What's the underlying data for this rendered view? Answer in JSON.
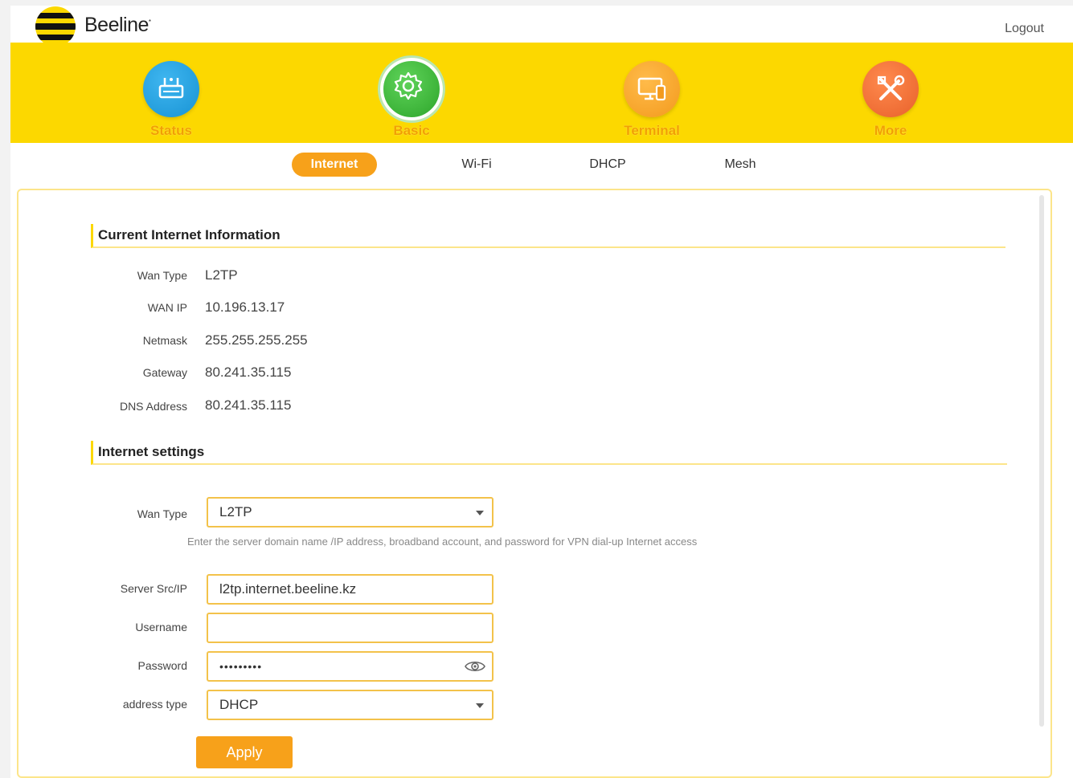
{
  "brand": {
    "name": "Beeline",
    "mark": "*"
  },
  "header": {
    "logout": "Logout"
  },
  "nav": [
    {
      "label": "Status",
      "icon": "router-icon",
      "color": "#1893d4"
    },
    {
      "label": "Basic",
      "icon": "gear-icon",
      "color": "#2da52a",
      "active": true
    },
    {
      "label": "Terminal",
      "icon": "devices-icon",
      "color": "#f39a1d"
    },
    {
      "label": "More",
      "icon": "tools-icon",
      "color": "#e8612a"
    }
  ],
  "tabs": [
    {
      "label": "Internet",
      "active": true
    },
    {
      "label": "Wi-Fi"
    },
    {
      "label": "DHCP"
    },
    {
      "label": "Mesh"
    }
  ],
  "current": {
    "title": "Current Internet Information",
    "rows": [
      {
        "label": "Wan Type",
        "value": "L2TP"
      },
      {
        "label": "WAN IP",
        "value": "10.196.13.17"
      },
      {
        "label": "Netmask",
        "value": "255.255.255.255"
      },
      {
        "label": "Gateway",
        "value": "80.241.35.115"
      },
      {
        "label": "DNS Address",
        "value": "80.241.35.115"
      }
    ]
  },
  "settings": {
    "title": "Internet settings",
    "wan_type_label": "Wan Type",
    "wan_type_value": "L2TP",
    "hint": "Enter the server domain name /IP address, broadband account, and password for VPN dial-up Internet access",
    "server_label": "Server Src/IP",
    "server_value": "l2tp.internet.beeline.kz",
    "username_label": "Username",
    "username_value": "",
    "password_label": "Password",
    "password_value": "•••••••••",
    "address_type_label": "address type",
    "address_type_value": "DHCP",
    "apply": "Apply"
  },
  "colors": {
    "accent_yellow": "#fcd800",
    "accent_orange": "#f7a11a",
    "border": "#f3c24a"
  }
}
